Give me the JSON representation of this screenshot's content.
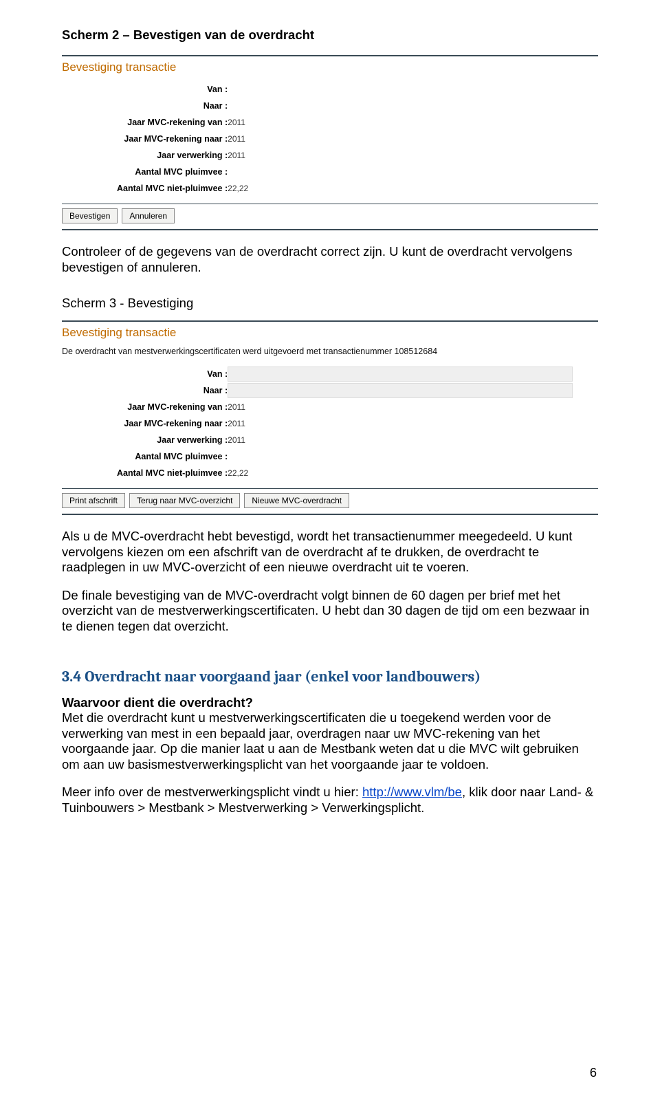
{
  "headings": {
    "scherm2": "Scherm 2 – Bevestigen van de overdracht",
    "scherm3": "Scherm 3 - Bevestiging",
    "section34": "3.4 Overdracht naar voorgaand jaar (enkel voor landbouwers)"
  },
  "panel": {
    "title": "Bevestiging transactie",
    "intro_line": "De overdracht van mestverwerkingscertificaten werd uitgevoerd met transactienummer 108512684",
    "fields": {
      "van": "Van",
      "naar": "Naar",
      "jaar_van": "Jaar MVC-rekening van",
      "jaar_naar": "Jaar MVC-rekening naar",
      "jaar_verwerking": "Jaar verwerking",
      "aantal_pluimvee": "Aantal MVC pluimvee",
      "aantal_niet_pluimvee": "Aantal MVC niet-pluimvee",
      "year": "2011",
      "amount": "22,22"
    }
  },
  "buttons": {
    "bevestigen": "Bevestigen",
    "annuleren": "Annuleren",
    "print": "Print afschrift",
    "terug": "Terug naar MVC-overzicht",
    "nieuwe": "Nieuwe MVC-overdracht"
  },
  "text": {
    "controleer": "Controleer of de gegevens van de overdracht correct zijn. U kunt de overdracht vervolgens bevestigen of annuleren.",
    "als_u": "Als u de MVC-overdracht hebt bevestigd, wordt het transactienummer meegedeeld. U kunt vervolgens kiezen om een afschrift van de overdracht af te drukken, de overdracht te raadplegen in uw MVC-overzicht of een nieuwe overdracht uit te voeren.",
    "de_finale": "De finale bevestiging van de MVC-overdracht volgt binnen de 60 dagen per brief met het overzicht van de mestverwerkingscertificaten. U hebt dan 30 dagen de tijd om een bezwaar in te dienen tegen dat overzicht.",
    "waarvoor_q": "Waarvoor dient die overdracht?",
    "waarvoor_a": "Met die overdracht kunt u mestverwerkingscertificaten die u toegekend werden voor de verwerking van mest in een bepaald jaar, overdragen naar uw MVC-rekening van het voorgaande jaar. Op die manier laat u aan de Mestbank weten dat u die MVC wilt gebruiken om aan uw basismestverwerkingsplicht van het voorgaande jaar te voldoen.",
    "meer_info_pre": "Meer info over de mestverwerkingsplicht vindt u hier: ",
    "meer_info_link": "http://www.vlm/be",
    "meer_info_post": ", klik door naar Land- & Tuinbouwers > Mestbank > Mestverwerking > Verwerkingsplicht."
  },
  "page_number": "6"
}
